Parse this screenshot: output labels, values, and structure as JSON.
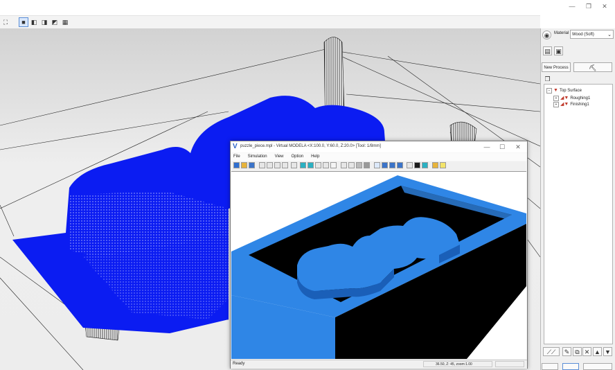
{
  "window": {
    "minimize_glyph": "—",
    "restore_glyph": "❐",
    "close_glyph": "✕"
  },
  "toolbar": {
    "view_icons": [
      "fit-icon",
      "iso-view-icon",
      "front-view-icon",
      "side-view-icon",
      "back-view-icon",
      "render-mode-icon"
    ]
  },
  "panel": {
    "material_label": "Material",
    "material_value": "Wood (Soft)",
    "new_process_label": "New Process",
    "tree": {
      "root": "Top Surface",
      "children": [
        "Roughing1",
        "Finishing1"
      ]
    }
  },
  "simulator": {
    "title": "puzzle_piece.mpl - Virtual MODELA <X:100.0, Y:60.0, Z:20.0> [Tool: 1/8mm]",
    "menu": [
      "File",
      "Simulation",
      "View",
      "Option",
      "Help"
    ],
    "status_ready": "Ready",
    "status_coords": "36.50, Z: 45, zoom:1.00"
  },
  "colors": {
    "model_blue": "#0b1cf2",
    "render_blue": "#2f86e6",
    "background_grey": "#e6e6e6"
  }
}
